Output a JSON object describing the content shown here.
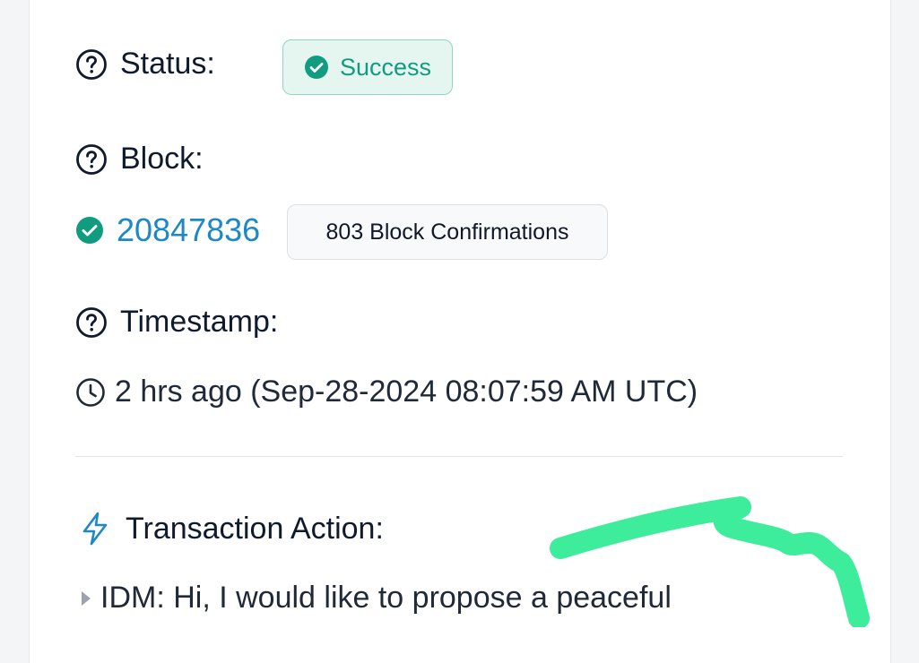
{
  "status": {
    "label": "Status:",
    "value": "Success",
    "icon": "help-circle-icon",
    "badge_icon": "check-circle-icon",
    "color": "#119c80"
  },
  "block": {
    "label": "Block:",
    "number": "20847836",
    "confirmations": "803 Block Confirmations",
    "icon": "help-circle-icon"
  },
  "timestamp": {
    "label": "Timestamp:",
    "value": "2 hrs ago (Sep-28-2024 08:07:59 AM UTC)",
    "icon": "clock-icon"
  },
  "transaction_action": {
    "title": "Transaction Action:",
    "message": "IDM: Hi, I would like to propose a peaceful",
    "icon": "lightning-bolt-icon"
  },
  "colors": {
    "accent_link": "#1e88c6",
    "success": "#119c80",
    "highlighter": "#3ded9c"
  }
}
